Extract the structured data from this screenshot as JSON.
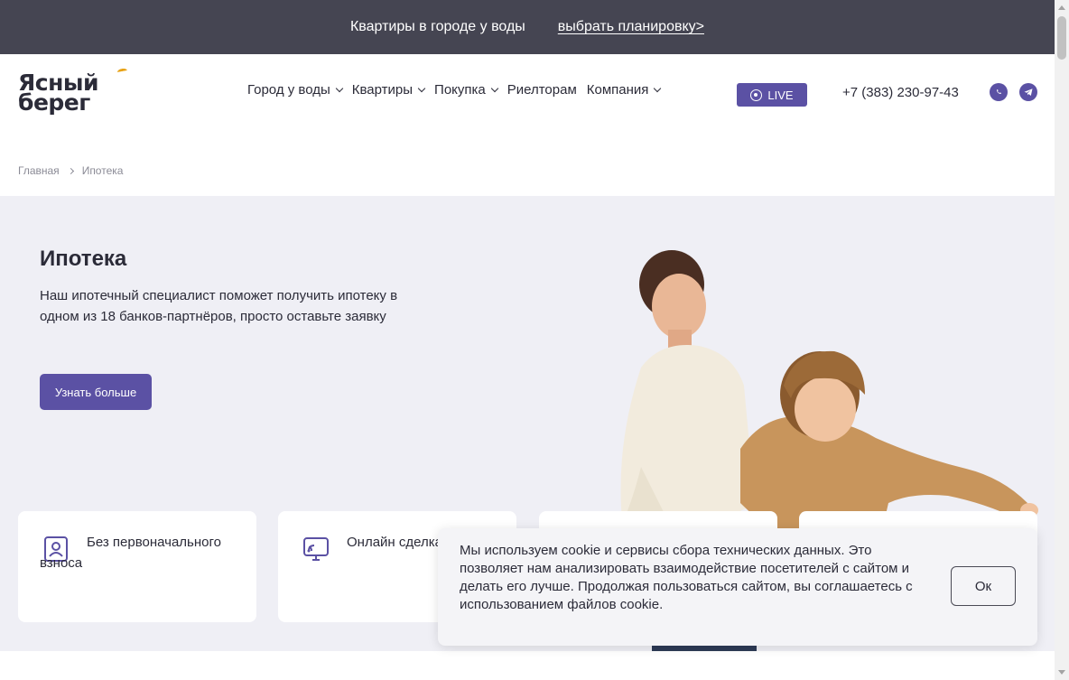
{
  "topbar": {
    "promo_text": "Квартиры в городе у воды",
    "promo_link": "выбрать планировку>"
  },
  "header": {
    "logo_line1": "Ясный",
    "logo_line2": "берег",
    "nav": [
      {
        "label": "Город у воды",
        "dropdown": true
      },
      {
        "label": "Квартиры",
        "dropdown": true
      },
      {
        "label": "Покупка",
        "dropdown": true
      },
      {
        "label": "Риелторам",
        "dropdown": false
      },
      {
        "label": "Компания",
        "dropdown": true
      }
    ],
    "live_label": "LIVE",
    "phone": "+7 (383) 230-97-43",
    "icons": {
      "live": "webcam-icon",
      "whatsapp": "whatsapp-icon",
      "telegram": "telegram-icon"
    }
  },
  "breadcrumb": {
    "home": "Главная",
    "current": "Ипотека"
  },
  "hero": {
    "title": "Ипотека",
    "text": "Наш ипотечный специалист поможет получить ипотеку в одном из 18 банков-партнёров, просто оставьте заявку",
    "button": "Узнать больше"
  },
  "features": [
    {
      "label": "Без первоначального взноса",
      "icon": "document-icon"
    },
    {
      "label": "Онлайн сделка",
      "icon": "monitor-icon"
    }
  ],
  "cookie": {
    "text": "Мы используем cookie и сервисы сбора технических данных. Это позволяет нам анализировать взаимодействие посетителей с сайтом и делать его лучше. Продолжая пользоваться сайтом, вы соглашаетесь с использованием файлов cookie.",
    "button": "Ок"
  },
  "colors": {
    "brand": "#5b51a4",
    "topbar": "#454552",
    "hero_bg": "#efeff5",
    "logo_accent": "#e8a317"
  }
}
